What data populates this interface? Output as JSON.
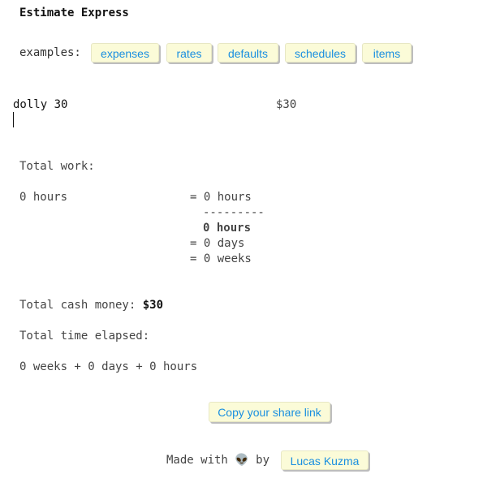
{
  "app": {
    "title": "Estimate Express"
  },
  "examples": {
    "label": "examples:",
    "items": [
      "expenses",
      "rates",
      "defaults",
      "schedules",
      "items"
    ]
  },
  "editor": {
    "line_text": "dolly 30",
    "line_price": "$30"
  },
  "work": {
    "heading": "Total work:",
    "left_value": "0 hours",
    "eq_hours": "= 0 hours",
    "divider": "---------",
    "total_hours": "0 hours",
    "eq_days": "= 0 days",
    "eq_weeks": "= 0 weeks"
  },
  "cash": {
    "label": "Total cash money:",
    "value": "$30"
  },
  "elapsed": {
    "heading": "Total time elapsed:",
    "summary": "0 weeks + 0 days + 0 hours"
  },
  "share": {
    "button_label": "Copy your share link"
  },
  "footer": {
    "made_with": "Made with",
    "by": "by",
    "author_link": "Lucas Kuzma",
    "emoji": "👽"
  }
}
